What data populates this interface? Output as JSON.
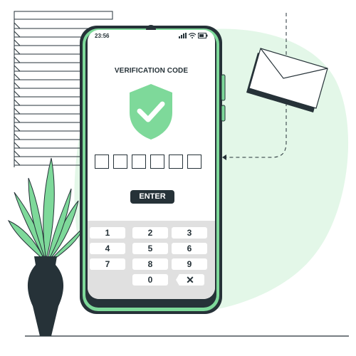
{
  "status_bar": {
    "time": "23:56",
    "icons": [
      "signal-icon",
      "wifi-icon",
      "battery-icon"
    ]
  },
  "verification": {
    "title": "VERIFICATION CODE",
    "code_box_count": 6,
    "enter_label": "ENTER"
  },
  "keypad": {
    "keys": [
      "1",
      "2",
      "3",
      "4",
      "5",
      "6",
      "7",
      "8",
      "9",
      "0"
    ],
    "delete_symbol": "✕"
  },
  "colors": {
    "accent_green": "#7ed99a",
    "light_green": "#e3f7e8",
    "dark": "#263238",
    "keypad_bg": "#e0e0e0"
  }
}
